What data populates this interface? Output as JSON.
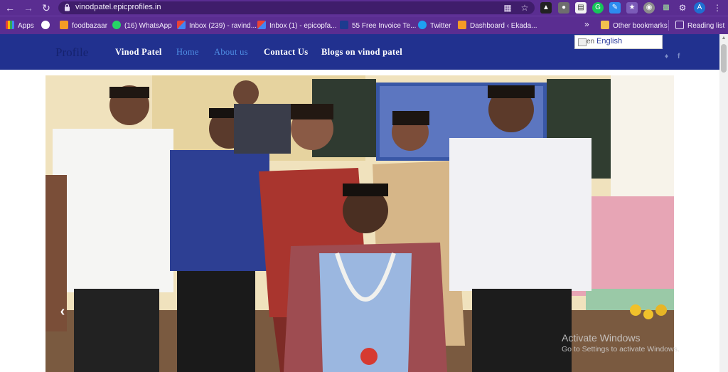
{
  "browser": {
    "url": "vinodpatel.epicprofiles.in",
    "profile_initial": "A",
    "bookmarks": [
      {
        "label": "Apps",
        "color": "#e0e0e0"
      },
      {
        "label": "",
        "color": "#ffffff"
      },
      {
        "label": "foodbazaar",
        "color": "#f59b25"
      },
      {
        "label": "(16) WhatsApp",
        "color": "#25d366"
      },
      {
        "label": "Inbox (239) - ravind...",
        "color": "#ea4335"
      },
      {
        "label": "Inbox (1) - epicopfa...",
        "color": "#ea4335"
      },
      {
        "label": "55 Free Invoice Te...",
        "color": "#1d3b8f"
      },
      {
        "label": "Twitter",
        "color": "#1da1f2"
      },
      {
        "label": "Dashboard ‹ Ekada...",
        "color": "#f59b25"
      }
    ],
    "overflow_label": "»",
    "other_bookmarks": "Other bookmarks",
    "reading_list": "Reading list"
  },
  "site": {
    "logo": "Profile",
    "nav": [
      "Vinod Patel",
      "Home",
      "About us",
      "Contact Us",
      "Blogs on vinod patel"
    ],
    "active_nav": "Home",
    "translate": {
      "code": "en",
      "language": "English"
    },
    "social": [
      "twitter-icon",
      "facebook-icon"
    ]
  },
  "watermark": {
    "line1": "Activate Windows",
    "line2": "Go to Settings to activate Windows."
  },
  "colors": {
    "browser_chrome": "#5a2d91",
    "site_header": "#21318f",
    "nav_active": "#4f8fe5"
  }
}
